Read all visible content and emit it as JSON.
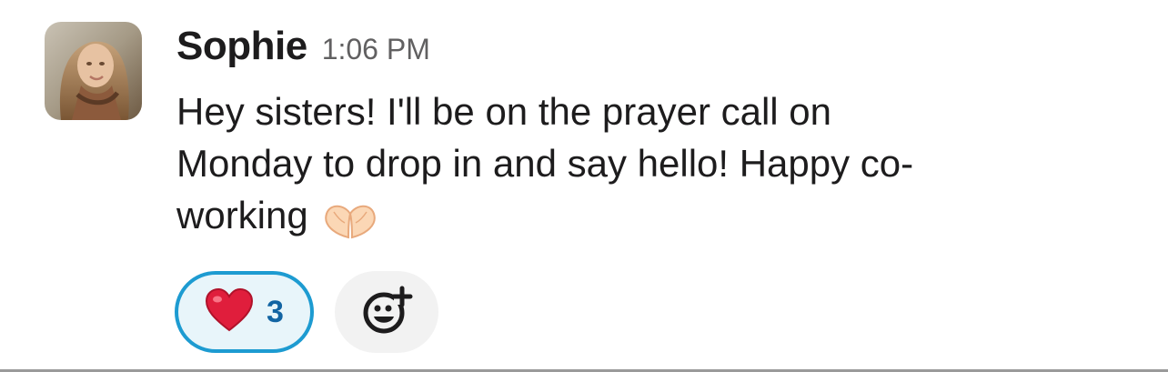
{
  "message": {
    "sender": "Sophie",
    "time": "1:06 PM",
    "text_lines": [
      "Hey sisters! I'll be on the prayer call on",
      "Monday to drop in and say hello! Happy co-",
      "working"
    ],
    "inline_emoji": "heart-hands"
  },
  "reactions": [
    {
      "emoji": "heart",
      "count": "3",
      "selected": true
    }
  ],
  "add_reaction_icon": "add-reaction-icon",
  "colors": {
    "text": "#1d1c1d",
    "timestamp": "#616061",
    "reaction_border": "#1d9bd1",
    "reaction_bg": "#e8f5fa",
    "reaction_count": "#1264a3",
    "heart": "#e01e3c"
  }
}
